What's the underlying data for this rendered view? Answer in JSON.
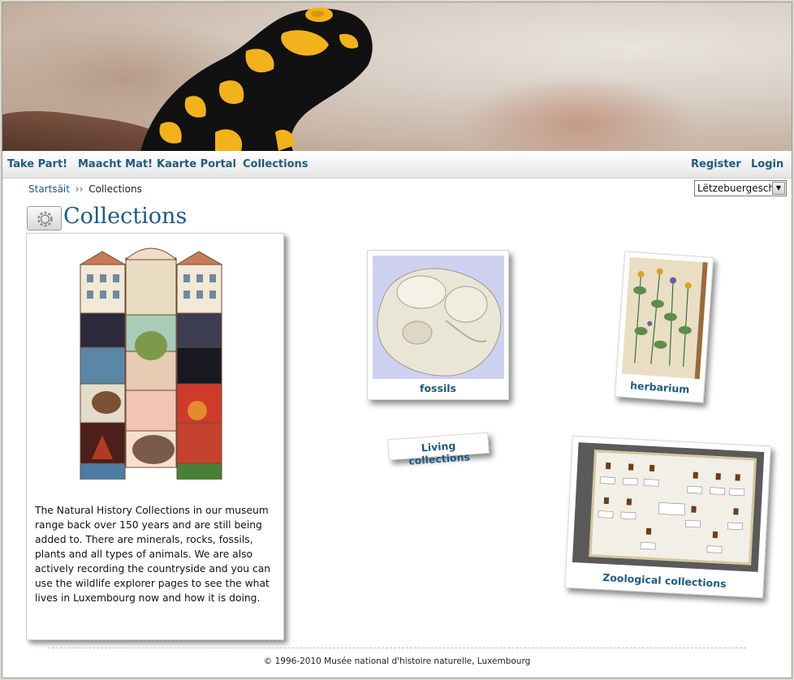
{
  "nav": {
    "left": [
      "Take Part!",
      "Maacht Mat!",
      "Kaarte Portal",
      "Collections"
    ],
    "right": [
      "Register",
      "Login"
    ]
  },
  "breadcrumb": {
    "home": "Startsäit",
    "separator": "››",
    "current": "Collections"
  },
  "language": {
    "selected": "Lëtzebuergesch"
  },
  "page": {
    "title": "Collections"
  },
  "intro": {
    "text": "The Natural History Collections in our museum range back over 150 years and are still being added to. There are minerals, rocks, fossils, plants and all types of animals. We are also actively recording the countryside and you can use the wildlife explorer pages to see the what lives in Luxembourg now and how it is doing."
  },
  "collections": [
    {
      "label": "fossils",
      "icon": "fossil-image"
    },
    {
      "label": "herbarium",
      "icon": "herbarium-book-image"
    },
    {
      "label": "Living collections",
      "icon": ""
    },
    {
      "label": "Zoological collections",
      "icon": "insect-display-case-image"
    }
  ],
  "footer": {
    "copyright": "© 1996-2010 Musée national d'histoire naturelle, Luxembourg"
  },
  "colors": {
    "link": "#1f5a80",
    "salamander_yellow": "#f2b21c",
    "salamander_black": "#111111"
  }
}
